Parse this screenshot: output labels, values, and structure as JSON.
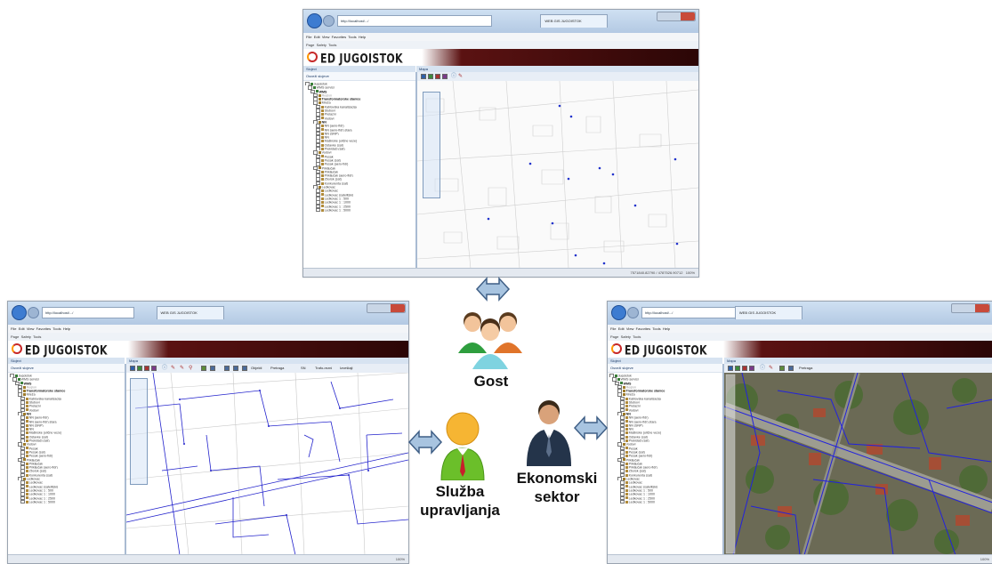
{
  "browser": {
    "address_text": "http://localhost/.../",
    "tab_title": "WEB GIS JUGOISTOK",
    "menu_items": [
      "File",
      "Edit",
      "View",
      "Favorites",
      "Tools",
      "Help"
    ],
    "command_items": [
      "Page",
      "Safety",
      "Tools"
    ]
  },
  "app": {
    "logo_text": "ED JUGOISTOK",
    "slojevi_title": "Slojevi",
    "mapa_title": "Mapa",
    "refresh_label": "Osveži slojeve",
    "zoom_text": "100%",
    "coords_text": "7571840.82790 / 4787526.90712"
  },
  "tree": [
    {
      "label": "Jugoistok",
      "level": 0,
      "style": "normal"
    },
    {
      "label": "WMS servisi",
      "level": 1,
      "style": "normal"
    },
    {
      "label": "WMS",
      "level": 2,
      "style": "bold"
    },
    {
      "label": "Region",
      "level": 3,
      "style": "dim"
    },
    {
      "label": "Transformatorske stanice",
      "level": 3,
      "style": "bold"
    },
    {
      "label": "Mreža",
      "level": 3,
      "style": "normal"
    },
    {
      "label": "Kablovska kanalizacija",
      "level": 4,
      "style": "normal"
    },
    {
      "label": "Stubovi",
      "level": 4,
      "style": "normal"
    },
    {
      "label": "Prelazni",
      "level": 4,
      "style": "normal"
    },
    {
      "label": "Vodovi",
      "level": 4,
      "style": "normal"
    },
    {
      "label": "NN",
      "level": 3,
      "style": "bold"
    },
    {
      "label": "NN (aero-fidr)",
      "level": 4,
      "style": "normal"
    },
    {
      "label": "NN (aero-fidr) stara",
      "level": 4,
      "style": "normal"
    },
    {
      "label": "NN (SNP)",
      "level": 4,
      "style": "normal"
    },
    {
      "label": "NN",
      "level": 4,
      "style": "normal"
    },
    {
      "label": "Mašinske (ulične veze)",
      "level": 4,
      "style": "normal"
    },
    {
      "label": "Ostavke (sat)",
      "level": 4,
      "style": "normal"
    },
    {
      "label": "Prekidači (sat)",
      "level": 4,
      "style": "normal"
    },
    {
      "label": "Vodovi",
      "level": 3,
      "style": "normal"
    },
    {
      "label": "Pesak",
      "level": 4,
      "style": "normal"
    },
    {
      "label": "Pesak (sat)",
      "level": 4,
      "style": "normal"
    },
    {
      "label": "Pesak (aero-fidr)",
      "level": 4,
      "style": "normal"
    },
    {
      "label": "Priključak",
      "level": 3,
      "style": "normal"
    },
    {
      "label": "Priključak",
      "level": 4,
      "style": "normal"
    },
    {
      "label": "Priključak (aero-fidr)",
      "level": 4,
      "style": "normal"
    },
    {
      "label": "Zborsk (sat)",
      "level": 4,
      "style": "normal"
    },
    {
      "label": "Konkurenta (sat)",
      "level": 4,
      "style": "normal"
    },
    {
      "label": "Ledkovac",
      "level": 3,
      "style": "normal"
    },
    {
      "label": "Ledkovac",
      "level": 4,
      "style": "normal"
    },
    {
      "label": "Ledkovac (satelitski)",
      "level": 4,
      "style": "normal"
    },
    {
      "label": "Ledkovac 1 : 500",
      "level": 4,
      "style": "normal"
    },
    {
      "label": "Ledkovac 1 : 1000",
      "level": 4,
      "style": "normal"
    },
    {
      "label": "Ledkovac 1 : 2500",
      "level": 4,
      "style": "normal"
    },
    {
      "label": "Ledkovac 1 : 5000",
      "level": 4,
      "style": "normal"
    }
  ],
  "toolbars": {
    "left_extra": [
      "Objekti",
      "Pretraga",
      "SN",
      "Trafo-rezni",
      "Izveštaji"
    ],
    "right_extra": [
      "Pretraga"
    ]
  },
  "roles": {
    "guest": "Gost",
    "management_line1": "Služba",
    "management_line2": "upravljanja",
    "economic_line1": "Ekonomski",
    "economic_line2": "sektor"
  },
  "colors": {
    "banner_dark": "#3a0a0a",
    "map_lines": "#2222cc",
    "arrow_fill": "#a8c4e0",
    "arrow_stroke": "#3f5f86",
    "guest_person": "#2e9e3e",
    "management_person": "#6bbf2a",
    "economic_suit": "#24344a"
  }
}
